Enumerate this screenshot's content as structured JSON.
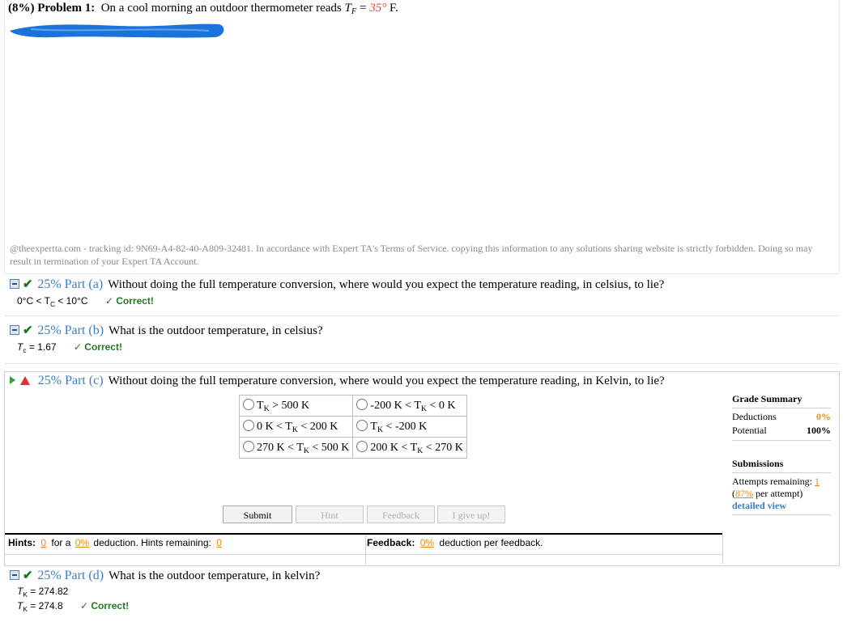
{
  "problem": {
    "weight": "(8%)",
    "title": "Problem 1:",
    "statement": "On a cool morning an outdoor thermometer reads",
    "var": "T",
    "var_sub": "F",
    "value": "35°",
    "unit": "F."
  },
  "tracking_text": "@theexpertta.com - tracking id: 9N69-A4-82-40-A809-32481. In accordance with Expert TA's Terms of Service. copying this information to any solutions sharing website is strictly forbidden. Doing so may result in termination of your Expert TA Account.",
  "parts": {
    "a": {
      "pct": "25%",
      "label": "Part (a)",
      "question": "Without doing the full temperature conversion, where would you expect the temperature reading, in celsius, to lie?",
      "answer_pre": "0°C < T",
      "answer_sub": "C",
      "answer_post": " < 10°C",
      "status": "✓ Correct!"
    },
    "b": {
      "pct": "25%",
      "label": "Part (b)",
      "question": "What is the outdoor temperature, in celsius?",
      "answer_var": "T",
      "answer_sub": "c",
      "answer_val": " = 1.67",
      "status": "✓ Correct!"
    },
    "c": {
      "pct": "25%",
      "label": "Part (c)",
      "question": "Without doing the full temperature conversion, where would you expect the temperature reading, in Kelvin, to lie?",
      "choices": [
        [
          "T",
          "K",
          " > 500 K",
          "",
          "",
          ""
        ],
        [
          "-200 K < T",
          "K",
          " < 0 K"
        ],
        [
          "0 K < T",
          "K",
          " < 200 K"
        ],
        [
          "T",
          "K",
          " < -200 K"
        ],
        [
          "270 K < T",
          "K",
          " < 500 K"
        ],
        [
          "200 K < T",
          "K",
          " < 270 K"
        ]
      ],
      "buttons": {
        "submit": "Submit",
        "hint": "Hint",
        "feedback": "Feedback",
        "give_up": "I give up!"
      },
      "hints": {
        "label": "Hints:",
        "count": "0",
        "for_a": "for a",
        "deduction_pct": "0%",
        "deduction_text": "deduction. Hints remaining:",
        "remaining": "0"
      },
      "feedback": {
        "label": "Feedback:",
        "pct": "0%",
        "text": "deduction per feedback."
      }
    },
    "d": {
      "pct": "25%",
      "label": "Part (d)",
      "question": "What is the outdoor temperature, in kelvin?",
      "line1_var": "T",
      "line1_sub": "K",
      "line1_val": " = 274.82",
      "line2_var": "T",
      "line2_sub": "K",
      "line2_val": " = 274.8",
      "status": "✓ Correct!"
    }
  },
  "grade_summary": {
    "title": "Grade Summary",
    "deductions_label": "Deductions",
    "deductions_value": "0%",
    "potential_label": "Potential",
    "potential_value": "100%",
    "submissions_title": "Submissions",
    "attempts_label": "Attempts remaining:",
    "attempts_value": "1",
    "per_attempt_pct": "87%",
    "per_attempt_text": "per attempt)",
    "detailed_view": "detailed view"
  },
  "colors": {
    "part_blue": "#3a7fbf",
    "correct_green": "#1f7a1f",
    "accent_orange": "#e28a16",
    "redaction_blue": "#1a73d9"
  }
}
